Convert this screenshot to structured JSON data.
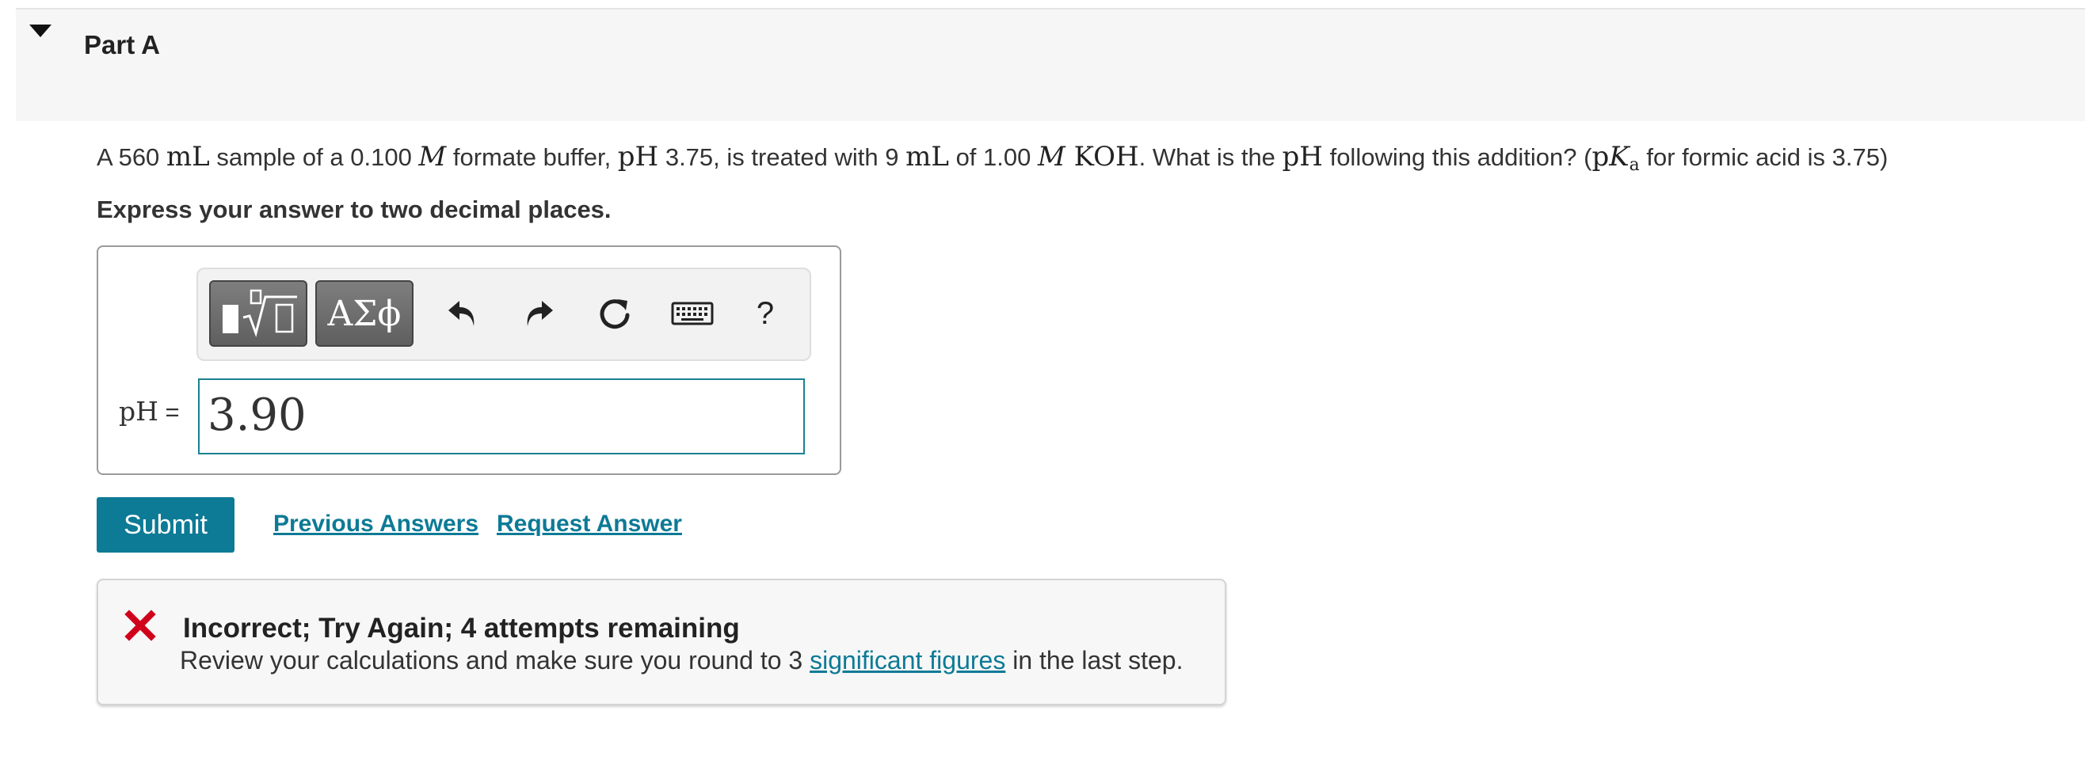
{
  "part": {
    "title": "Part A"
  },
  "question": {
    "t1": "A 560 ",
    "m1": "mL",
    "t2": " sample of a 0.100 ",
    "m2": "M",
    "t3": " formate buffer, ",
    "m3": "pH",
    "t4": " 3.75, is treated with 9 ",
    "m4": "mL",
    "t5": " of 1.00 ",
    "m5": "M",
    "m6": " KOH",
    "t6": ". What is the ",
    "m7": "pH",
    "t7": " following this addition? (",
    "m8": "p",
    "m9": "K",
    "m10": "a",
    "t8": " for formic acid is 3.75)"
  },
  "instruction": "Express your answer to two decimal places.",
  "toolbar": {
    "symbols_label": "ΑΣϕ",
    "help_label": "?",
    "icons": [
      "templates-icon",
      "greek-symbols-icon",
      "undo-icon",
      "redo-icon",
      "reset-icon",
      "keyboard-icon",
      "help-icon"
    ]
  },
  "answer": {
    "label_math": "pH",
    "label_eq": " =",
    "value": "3.90"
  },
  "actions": {
    "submit_label": "Submit",
    "previous_answers_label": "Previous Answers",
    "request_answer_label": "Request Answer"
  },
  "feedback": {
    "title": "Incorrect; Try Again; 4 attempts remaining",
    "body_before": "Review your calculations and make sure you round to 3 ",
    "body_link": "significant figures",
    "body_after": " in the last step."
  },
  "colors": {
    "accent": "#0d7a96",
    "error": "#d0021b",
    "header_bg": "#f6f6f6",
    "input_border": "#1b8190"
  }
}
